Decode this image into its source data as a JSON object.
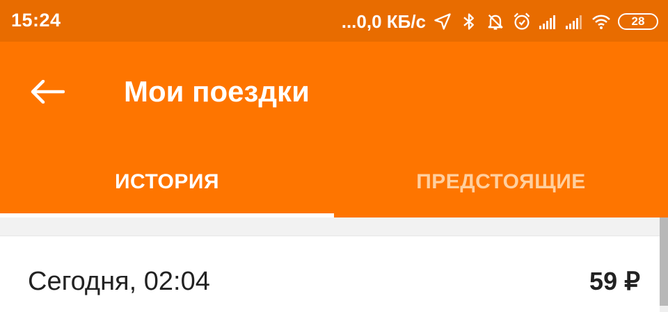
{
  "status_bar": {
    "time": "15:24",
    "network_speed": "...0,0 КБ/с",
    "battery_level": "28",
    "icons": [
      "location-icon",
      "bluetooth-icon",
      "mute-bell-icon",
      "alarm-icon",
      "signal-icon",
      "signal-icon",
      "wifi-icon",
      "battery-icon"
    ]
  },
  "app_bar": {
    "back_icon": "arrow-left-icon",
    "title": "Мои поездки"
  },
  "tabs": [
    {
      "label": "ИСТОРИЯ",
      "selected": true
    },
    {
      "label": "ПРЕДСТОЯЩИЕ",
      "selected": false
    }
  ],
  "trips": [
    {
      "date": "Сегодня, 02:04",
      "price": "59 ₽"
    }
  ],
  "colors": {
    "status_bar": "#e86c00",
    "app_bar": "#fe7500",
    "tab_active": "#ffffff",
    "tab_inactive": "#ffcf9e"
  }
}
